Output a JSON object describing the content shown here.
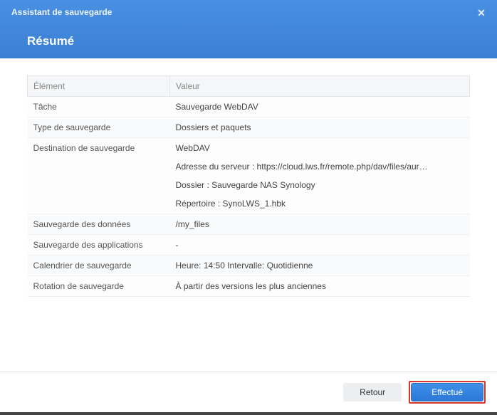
{
  "header": {
    "app_title": "Assistant de sauvegarde",
    "page_title": "Résumé"
  },
  "icons": {
    "close": "✕"
  },
  "table": {
    "col_element": "Élément",
    "col_value": "Valeur",
    "rows": {
      "task": {
        "label": "Tâche",
        "value": "Sauvegarde WebDAV"
      },
      "type": {
        "label": "Type de sauvegarde",
        "value": "Dossiers et paquets"
      },
      "destination": {
        "label": "Destination de sauvegarde",
        "line1": "WebDAV",
        "line2": "Adresse du serveur : https://cloud.lws.fr/remote.php/dav/files/aur…",
        "line3": "Dossier : Sauvegarde NAS Synology",
        "line4": "Répertoire : SynoLWS_1.hbk"
      },
      "data_backup": {
        "label": "Sauvegarde des données",
        "value": "/my_files"
      },
      "app_backup": {
        "label": "Sauvegarde des applications",
        "value": "-"
      },
      "schedule": {
        "label": "Calendrier de sauvegarde",
        "value": "Heure: 14:50 Intervalle: Quotidienne"
      },
      "rotation": {
        "label": "Rotation de sauvegarde",
        "value": "À partir des versions les plus anciennes"
      }
    }
  },
  "footer": {
    "back_label": "Retour",
    "done_label": "Effectué"
  }
}
